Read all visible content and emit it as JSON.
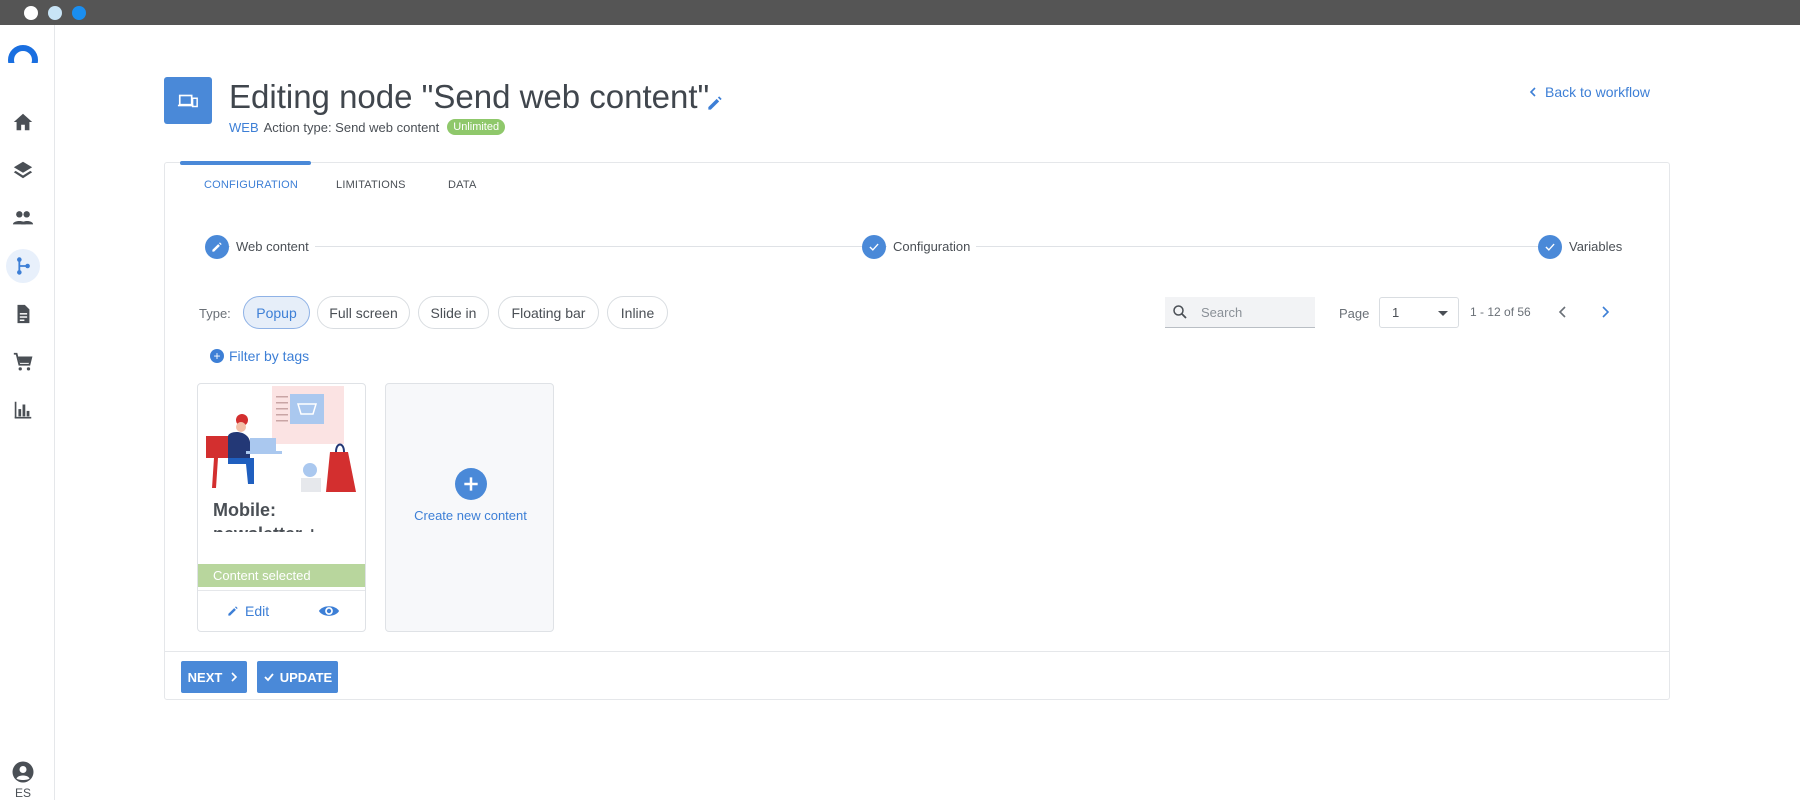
{
  "window": {
    "controls": [
      "close",
      "minimize",
      "maximize"
    ]
  },
  "sidebar": {
    "items": [
      {
        "name": "home",
        "icon": "home-icon"
      },
      {
        "name": "layers",
        "icon": "layers-icon"
      },
      {
        "name": "audience",
        "icon": "people-icon"
      },
      {
        "name": "workflows",
        "icon": "workflow-icon",
        "active": true
      },
      {
        "name": "documents",
        "icon": "document-icon"
      },
      {
        "name": "commerce",
        "icon": "cart-icon"
      },
      {
        "name": "reports",
        "icon": "bar-chart-icon"
      }
    ],
    "user_initials": "ES"
  },
  "header": {
    "title": "Editing node \"Send web content\"",
    "channel": "WEB",
    "action_type": "Action type: Send web content",
    "badge": "Unlimited",
    "back_link": "Back to workflow"
  },
  "tabs": [
    {
      "label": "CONFIGURATION",
      "active": true
    },
    {
      "label": "LIMITATIONS"
    },
    {
      "label": "DATA"
    }
  ],
  "steps": [
    {
      "label": "Web content",
      "icon": "pencil-icon"
    },
    {
      "label": "Configuration",
      "icon": "check-icon"
    },
    {
      "label": "Variables",
      "icon": "check-icon"
    }
  ],
  "filters": {
    "type_label": "Type:",
    "types": [
      {
        "label": "Popup",
        "active": true
      },
      {
        "label": "Full screen"
      },
      {
        "label": "Slide in"
      },
      {
        "label": "Floating bar"
      },
      {
        "label": "Inline"
      }
    ],
    "filter_tags": "Filter by tags",
    "search_placeholder": "Search"
  },
  "pagination": {
    "page_label": "Page",
    "current_page": "1",
    "range": "1 - 12 of 56"
  },
  "content_cards": [
    {
      "title": "Mobile: newsletter + discount",
      "status": "Content selected",
      "edit_label": "Edit"
    }
  ],
  "create_card": {
    "label": "Create new content"
  },
  "buttons": {
    "next": "NEXT",
    "update": "UPDATE"
  },
  "colors": {
    "accent": "#4a89d8",
    "link": "#3d7fd6",
    "success": "#8fc86b",
    "selected": "#b8d69d"
  }
}
